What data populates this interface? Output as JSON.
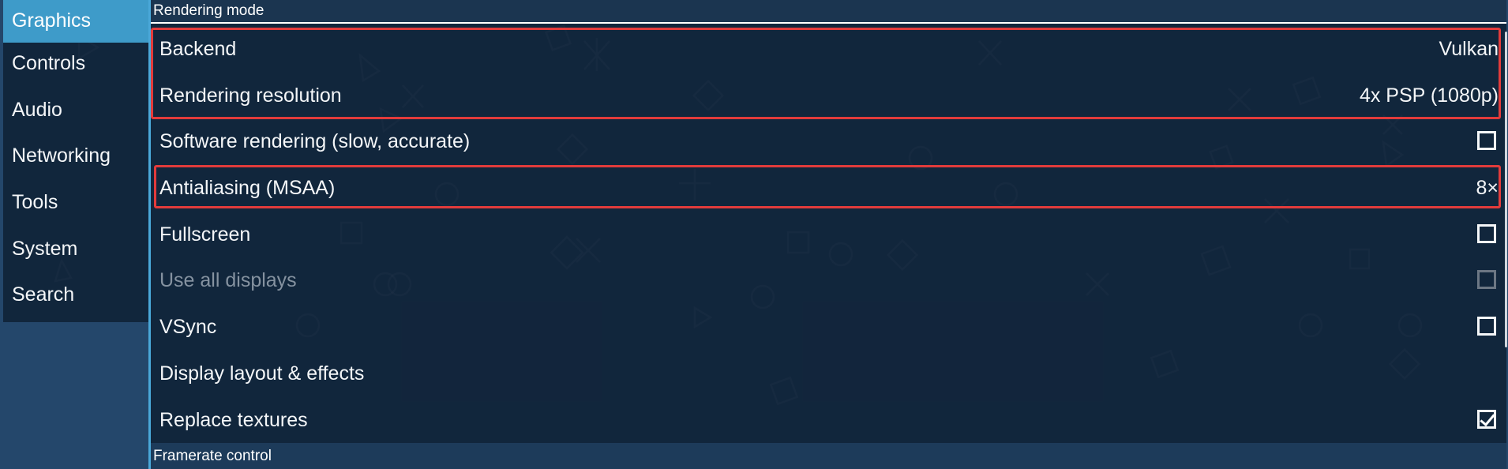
{
  "sidebar": {
    "items": [
      {
        "label": "Graphics",
        "active": true
      },
      {
        "label": "Controls"
      },
      {
        "label": "Audio"
      },
      {
        "label": "Networking"
      },
      {
        "label": "Tools"
      },
      {
        "label": "System"
      },
      {
        "label": "Search"
      }
    ]
  },
  "main": {
    "section_rendering": "Rendering mode",
    "section_framerate": "Framerate control",
    "rows": {
      "backend": {
        "label": "Backend",
        "value": "Vulkan"
      },
      "resolution": {
        "label": "Rendering resolution",
        "value": "4x PSP (1080p)"
      },
      "software": {
        "label": "Software rendering (slow, accurate)",
        "checked": false
      },
      "msaa": {
        "label": "Antialiasing (MSAA)",
        "value": "8×"
      },
      "fullscreen": {
        "label": "Fullscreen",
        "checked": false
      },
      "all_displays": {
        "label": "Use all displays",
        "checked": false,
        "disabled": true
      },
      "vsync": {
        "label": "VSync",
        "checked": false
      },
      "layout": {
        "label": "Display layout & effects"
      },
      "textures": {
        "label": "Replace textures",
        "checked": true
      }
    }
  },
  "colors": {
    "background": "#24476b",
    "active_tab": "#3e9bc9",
    "highlight": "#e23b3b",
    "panel": "#0e1e32"
  },
  "icons": {
    "background_shapes": [
      "circle-icon",
      "cross-icon",
      "square-icon",
      "triangle-icon"
    ]
  }
}
